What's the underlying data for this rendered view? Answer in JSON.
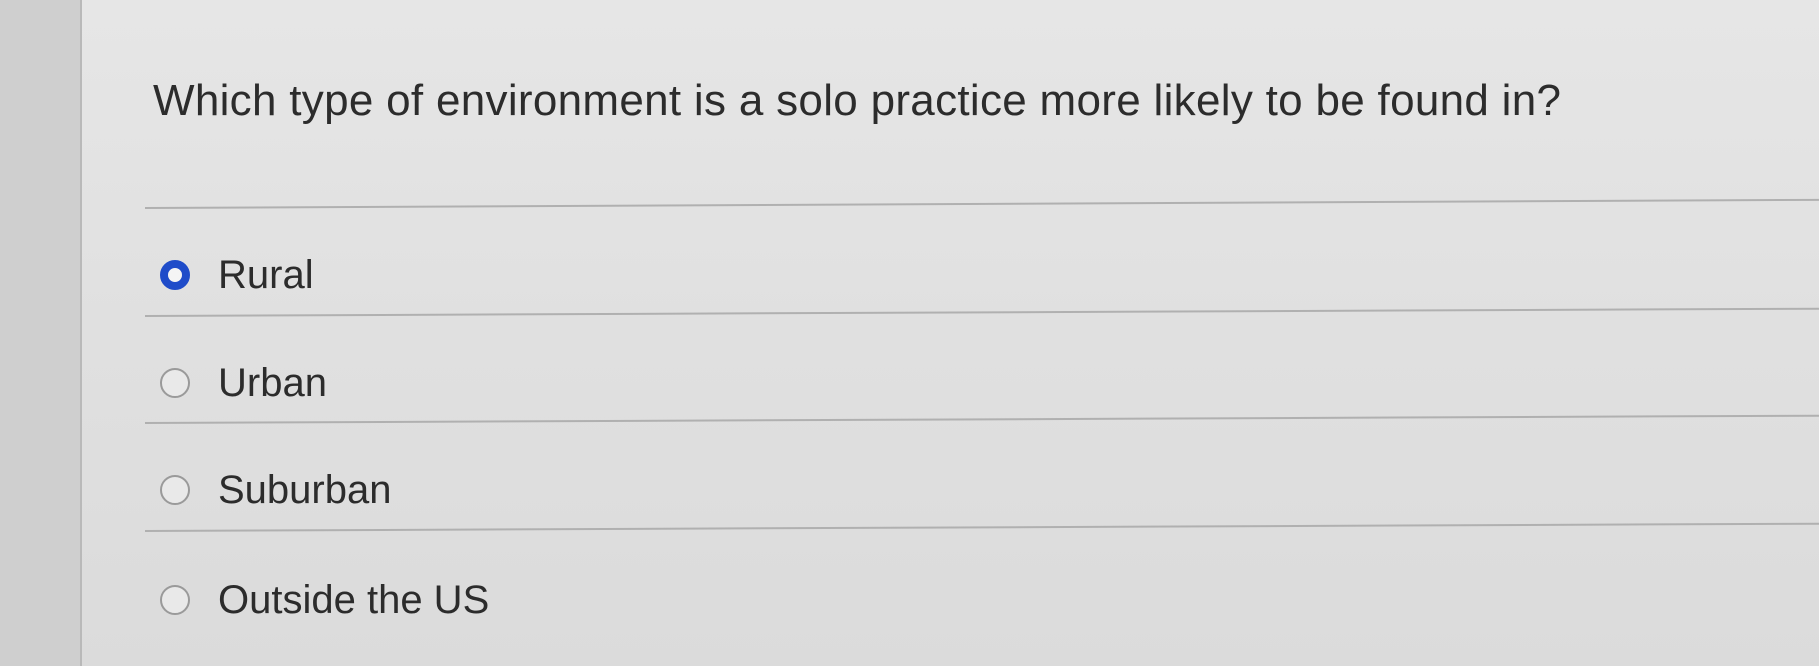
{
  "quiz": {
    "question": "Which type of environment is a solo practice more likely to be found in?",
    "answers": [
      {
        "label": "Rural",
        "selected": true
      },
      {
        "label": "Urban",
        "selected": false
      },
      {
        "label": "Suburban",
        "selected": false
      },
      {
        "label": "Outside the US",
        "selected": false
      }
    ],
    "colors": {
      "selected_radio": "#1f4cc9",
      "text": "#2c2c2c",
      "divider": "#b0b0b0"
    }
  }
}
